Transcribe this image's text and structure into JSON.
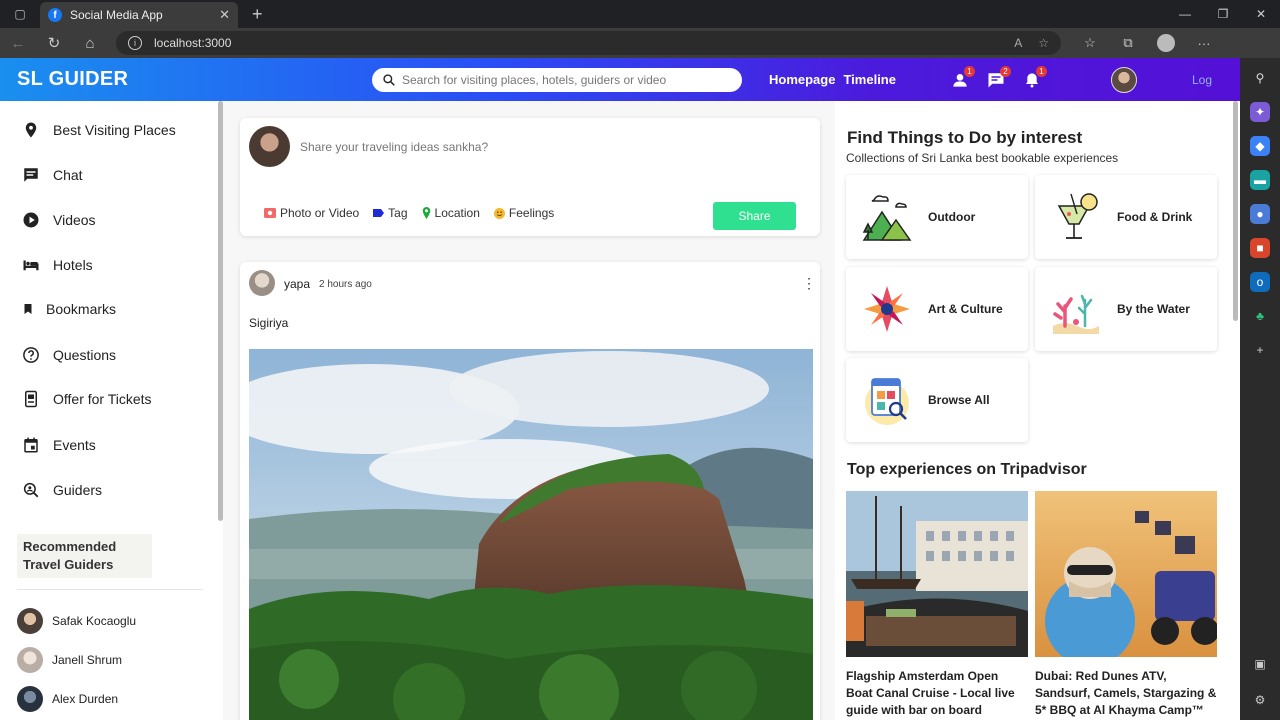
{
  "browser": {
    "tab_title": "Social Media App",
    "url": "localhost:3000"
  },
  "header": {
    "logo": "SL GUIDER",
    "search_placeholder": "Search for visiting places, hotels, guiders or video",
    "links": [
      "Homepage",
      "Timeline"
    ],
    "badges": {
      "friends": "1",
      "messages": "2",
      "notifications": "1"
    },
    "logout_label": "Log"
  },
  "sidebar": {
    "items": [
      {
        "label": "Best Visiting Places",
        "icon": "location-pin-icon"
      },
      {
        "label": "Chat",
        "icon": "chat-icon"
      },
      {
        "label": "Videos",
        "icon": "play-circle-icon"
      },
      {
        "label": "Hotels",
        "icon": "bed-icon"
      },
      {
        "label": "Bookmarks",
        "icon": "bookmark-icon"
      },
      {
        "label": "Questions",
        "icon": "help-circle-icon"
      },
      {
        "label": "Offer for Tickets",
        "icon": "ticket-icon"
      },
      {
        "label": "Events",
        "icon": "calendar-icon"
      },
      {
        "label": "Guiders",
        "icon": "person-search-icon"
      }
    ],
    "recommended_title": "Recommended Travel Guiders",
    "guiders": [
      {
        "name": "Safak Kocaoglu"
      },
      {
        "name": "Janell Shrum"
      },
      {
        "name": "Alex Durden"
      }
    ]
  },
  "share": {
    "placeholder": "Share your traveling ideas sankha?",
    "options": [
      "Photo or Video",
      "Tag",
      "Location",
      "Feelings"
    ],
    "button": "Share"
  },
  "post": {
    "user": "yapa",
    "time": "2 hours ago",
    "text": "Sigiriya"
  },
  "interests": {
    "title": "Find Things to Do by interest",
    "subtitle": "Collections of Sri Lanka best bookable experiences",
    "categories": [
      "Outdoor",
      "Food & Drink",
      "Art & Culture",
      "By the Water",
      "Browse All"
    ]
  },
  "experiences": {
    "title": "Top experiences on Tripadvisor",
    "items": [
      {
        "title": "Flagship Amsterdam Open Boat Canal Cruise - Local live guide with bar on board"
      },
      {
        "title": "Dubai: Red Dunes ATV, Sandsurf, Camels, Stargazing & 5* BBQ at Al Khayma Camp™"
      }
    ]
  },
  "colors": {
    "header_gradient_start": "#1a8fef",
    "header_gradient_end": "#5410d6",
    "share_button": "#2ee08f",
    "badge": "#e53935"
  }
}
